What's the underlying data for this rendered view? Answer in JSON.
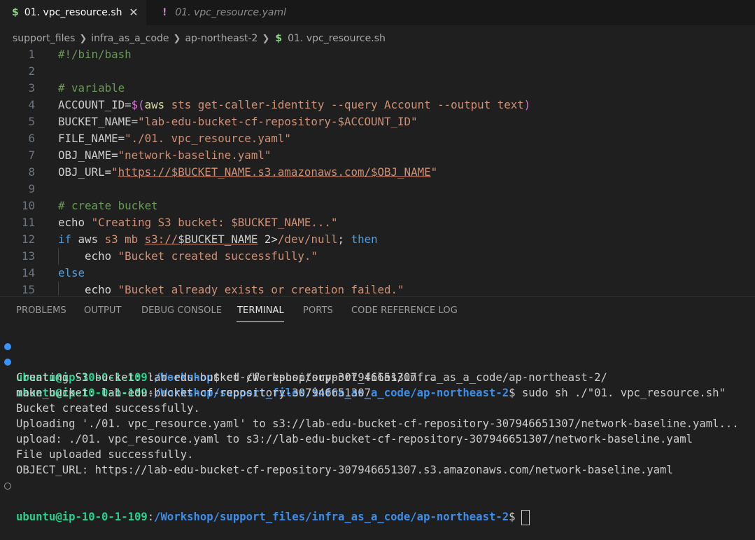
{
  "tabs": [
    {
      "label": "01. vpc_resource.sh",
      "icon": "$",
      "active": true
    },
    {
      "label": "01. vpc_resource.yaml",
      "icon": "!",
      "active": false
    }
  ],
  "breadcrumb": [
    "support_files",
    "infra_as_a_code",
    "ap-northeast-2",
    "01. vpc_resource.sh"
  ],
  "editor": {
    "line_numbers": [
      "1",
      "2",
      "3",
      "4",
      "5",
      "6",
      "7",
      "8",
      "9",
      "10",
      "11",
      "12",
      "13",
      "14",
      "15"
    ],
    "lines": [
      [
        {
          "t": "#!/bin/bash",
          "c": "c"
        }
      ],
      [],
      [
        {
          "t": "# variable",
          "c": "c"
        }
      ],
      [
        {
          "t": "ACCOUNT_ID=",
          "c": "v"
        },
        {
          "t": "$(",
          "c": "br"
        },
        {
          "t": "aws ",
          "c": "f"
        },
        {
          "t": "sts get-caller-identity --query Account --output text",
          "c": "s"
        },
        {
          "t": ")",
          "c": "br"
        }
      ],
      [
        {
          "t": "BUCKET_NAME=",
          "c": "v"
        },
        {
          "t": "\"lab-edu-bucket-cf-repository-$ACCOUNT_ID\"",
          "c": "s"
        }
      ],
      [
        {
          "t": "FILE_NAME=",
          "c": "v"
        },
        {
          "t": "\"./01. vpc_resource.yaml\"",
          "c": "s"
        }
      ],
      [
        {
          "t": "OBJ_NAME=",
          "c": "v"
        },
        {
          "t": "\"network-baseline.yaml\"",
          "c": "s"
        }
      ],
      [
        {
          "t": "OBJ_URL=",
          "c": "v"
        },
        {
          "t": "\"",
          "c": "s"
        },
        {
          "t": "https://$BUCKET_NAME.s3.amazonaws.com/$OBJ_NAME",
          "c": "s u"
        },
        {
          "t": "\"",
          "c": "s"
        }
      ],
      [],
      [
        {
          "t": "# create bucket",
          "c": "c"
        }
      ],
      [
        {
          "t": "echo ",
          "c": "w"
        },
        {
          "t": "\"Creating S3 bucket: $BUCKET_NAME...\"",
          "c": "s"
        }
      ],
      [
        {
          "t": "if ",
          "c": "k"
        },
        {
          "t": "aws ",
          "c": "w"
        },
        {
          "t": "s3 mb ",
          "c": "s"
        },
        {
          "t": "s3://",
          "c": "s u"
        },
        {
          "t": "$BUCKET_NAME",
          "c": "v u"
        },
        {
          "t": " 2>",
          "c": "w"
        },
        {
          "t": "/dev/null",
          "c": "s"
        },
        {
          "t": "; ",
          "c": "w"
        },
        {
          "t": "then",
          "c": "k"
        }
      ],
      [
        {
          "t": "    echo ",
          "c": "w"
        },
        {
          "t": "\"Bucket created successfully.\"",
          "c": "s"
        }
      ],
      [
        {
          "t": "else",
          "c": "k"
        }
      ],
      [
        {
          "t": "    echo ",
          "c": "w"
        },
        {
          "t": "\"Bucket already exists or creation failed.\"",
          "c": "s"
        }
      ]
    ]
  },
  "panel": {
    "tabs": [
      "PROBLEMS",
      "OUTPUT",
      "DEBUG CONSOLE",
      "TERMINAL",
      "PORTS",
      "CODE REFERENCE LOG"
    ],
    "active_tab": "TERMINAL"
  },
  "terminal": {
    "user_host": "ubuntu@ip-10-0-1-109",
    "colon": ":",
    "prompt1_path": "/Workshop",
    "prompt1_cmd": "$ cd /Workshop/support_files/infra_as_a_code/ap-northeast-2/",
    "prompt2_path": "/Workshop/support_files/infra_as_a_code/ap-northeast-2",
    "prompt2_cmd": "$ sudo sh ./\"01. vpc_resource.sh\"",
    "output": [
      "Creating S3 bucket: lab-edu-bucket-cf-repository-307946651307...",
      "make_bucket: lab-edu-bucket-cf-repository-307946651307",
      "Bucket created successfully.",
      "Uploading './01. vpc_resource.yaml' to s3://lab-edu-bucket-cf-repository-307946651307/network-baseline.yaml...",
      "upload: ./01. vpc_resource.yaml to s3://lab-edu-bucket-cf-repository-307946651307/network-baseline.yaml",
      "File uploaded successfully.",
      "OBJECT_URL: https://lab-edu-bucket-cf-repository-307946651307.s3.amazonaws.com/network-baseline.yaml"
    ],
    "prompt3_path": "/Workshop/support_files/infra_as_a_code/ap-northeast-2",
    "prompt3_cmd": "$"
  },
  "colors": {
    "editor_bg": "#1f1f1f",
    "comment": "#6a9955",
    "string": "#ce9178",
    "keyword": "#569cd6",
    "terminal_user": "#23d18b",
    "terminal_path": "#3b8eea"
  }
}
